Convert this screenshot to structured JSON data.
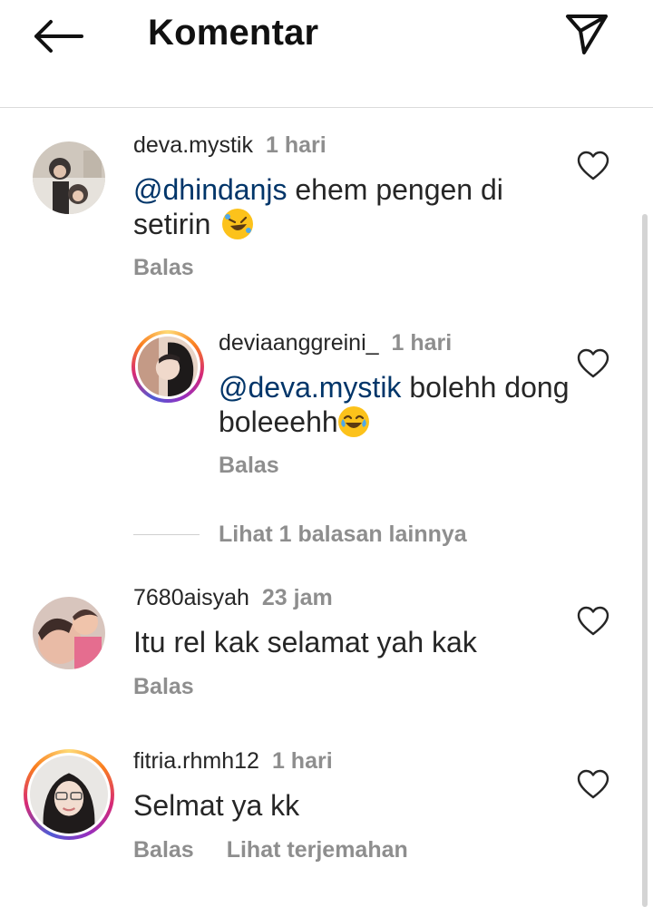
{
  "header": {
    "title": "Komentar"
  },
  "comments": [
    {
      "username": "deva.mystik",
      "time": "1 hari",
      "mention": "@dhindanjs",
      "text": " ehem pengen di setirin",
      "reply_label": "Balas"
    },
    {
      "username": "deviaanggreini_",
      "time": "1 hari",
      "mention": "@deva.mystik",
      "text": " bolehh dong boleeehh",
      "reply_label": "Balas"
    },
    {
      "username": "7680aisyah",
      "time": "23 jam",
      "text": "Itu rel kak selamat yah kak",
      "reply_label": "Balas"
    },
    {
      "username": "fitria.rhmh12",
      "time": "1 hari",
      "text": "Selmat ya kk",
      "reply_label": "Balas",
      "translate_label": "Lihat terjemahan"
    }
  ],
  "more_replies_label": "Lihat 1 balasan lainnya",
  "colors": {
    "mention": "#003569",
    "meta_gray": "#8e8e8e",
    "text": "#262626"
  },
  "icons": [
    "back-arrow-icon",
    "send-icon",
    "heart-icon",
    "rofl-emoji",
    "joy-emoji"
  ]
}
